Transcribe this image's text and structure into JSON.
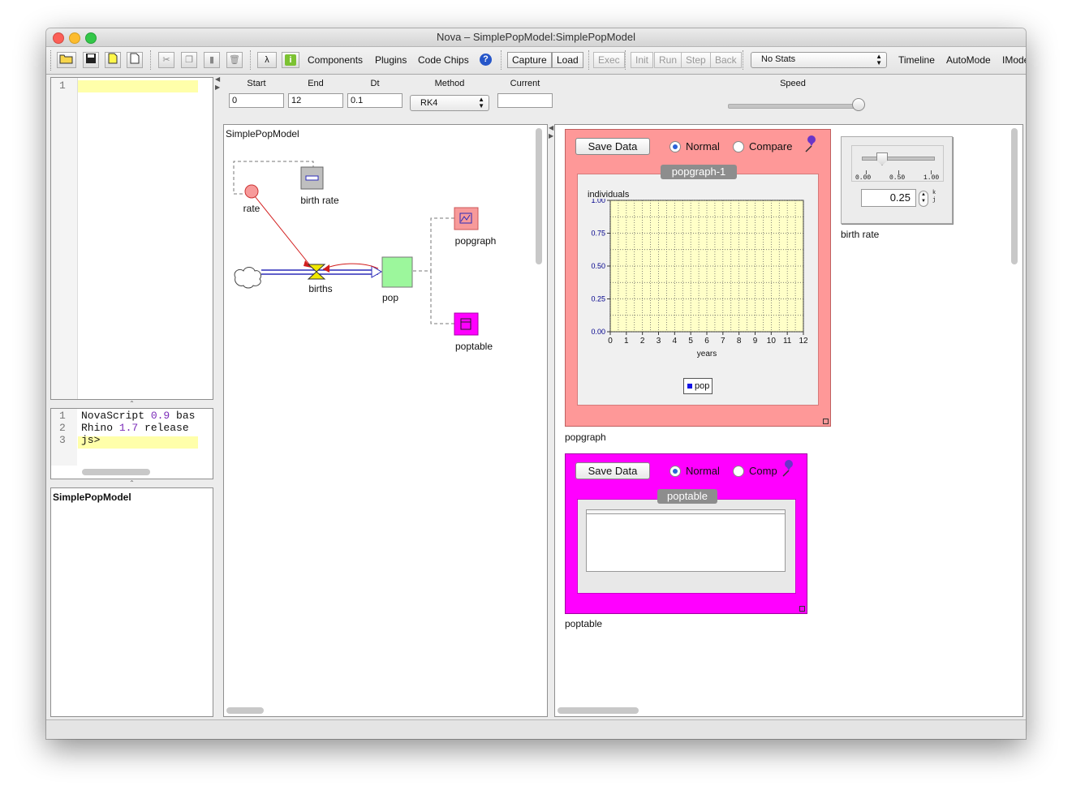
{
  "window": {
    "title": "Nova – SimplePopModel:SimplePopModel"
  },
  "toolbar": {
    "lambda": "λ",
    "info": "i",
    "components": "Components",
    "plugins": "Plugins",
    "code_chips": "Code Chips",
    "help": "?",
    "capture": "Capture",
    "load": "Load",
    "exec": "Exec",
    "init": "Init",
    "run": "Run",
    "step": "Step",
    "back": "Back",
    "stats_select": "No Stats",
    "timeline": "Timeline",
    "automode": "AutoMode",
    "imode": "IMode"
  },
  "editor": {
    "line1": "1",
    "console_lines": [
      {
        "num": "1",
        "parts": [
          "NovaScript ",
          "0.9",
          " bas"
        ]
      },
      {
        "num": "2",
        "parts": [
          "Rhino ",
          "1.7",
          " release"
        ]
      },
      {
        "num": "3",
        "parts": [
          "js>",
          "",
          ""
        ]
      }
    ],
    "project_title": "SimplePopModel"
  },
  "sim": {
    "start_label": "Start",
    "start": "0",
    "end_label": "End",
    "end": "12",
    "dt_label": "Dt",
    "dt": "0.1",
    "method_label": "Method",
    "method": "RK4",
    "current_label": "Current",
    "current": "",
    "speed_label": "Speed",
    "speed_fraction": 1.0
  },
  "model": {
    "title": "SimplePopModel",
    "nodes": {
      "rate": "rate",
      "birth_rate": "birth rate",
      "births": "births",
      "pop": "pop",
      "popgraph": "popgraph",
      "poptable": "poptable"
    }
  },
  "popgraph": {
    "save": "Save Data",
    "normal": "Normal",
    "compare": "Compare",
    "tab": "popgraph-1",
    "caption": "popgraph",
    "legend": "pop",
    "colors": {
      "panel": "#fe9898",
      "plot": "#ffffc8",
      "axis": "#00008b"
    }
  },
  "chart_data": {
    "type": "line",
    "ylabel": "individuals",
    "xlabel": "years",
    "x_ticks": [
      "0",
      "1",
      "2",
      "3",
      "4",
      "5",
      "6",
      "7",
      "8",
      "9",
      "10",
      "11",
      "12"
    ],
    "y_ticks": [
      "1.00",
      "0.75",
      "0.50",
      "0.25",
      "0.00"
    ],
    "xlim": [
      0,
      12
    ],
    "ylim": [
      0,
      1
    ],
    "grid": true,
    "legend_position": "bottom",
    "series": [
      {
        "name": "pop",
        "values": []
      }
    ]
  },
  "poptable": {
    "save": "Save Data",
    "normal": "Normal",
    "compare": "Comp",
    "tab": "poptable",
    "caption": "poptable",
    "colors": {
      "panel": "#ff00ff"
    }
  },
  "slider_widget": {
    "ticks": [
      "0.00",
      "0.50",
      "1.00"
    ],
    "value": "0.25",
    "value_fraction": 0.25,
    "k": "k",
    "j": "j",
    "caption": "birth rate"
  }
}
